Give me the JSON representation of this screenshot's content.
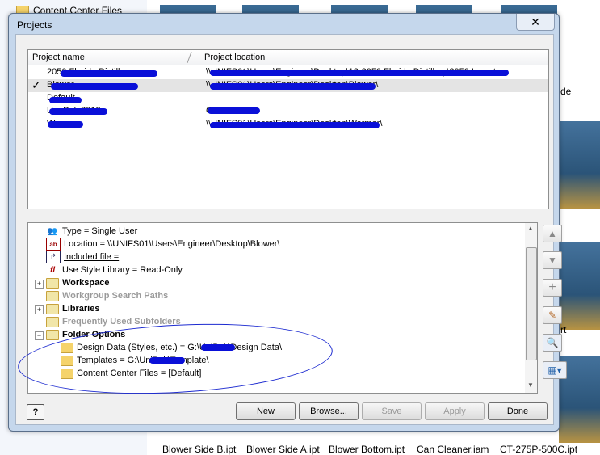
{
  "background": {
    "sidebar_item": "Content Center Files",
    "file_labels": [
      "Blower Side B.ipt",
      "Blower Side A.ipt",
      "Blower Bottom.ipt",
      "Can Cleaner.iam",
      "CT-275P-500C.ipt"
    ],
    "side_fragments": [
      "de",
      "rt"
    ]
  },
  "dialog": {
    "title": "Projects",
    "close_symbol": "✕",
    "columns": [
      "Project name",
      "Project location"
    ],
    "projects": [
      {
        "name": "2050 Florida Distillery",
        "location": "\\\\UNIFS01\\Users\\Engineer\\Desktop\\12-2050 Florida Distillery\\2050 Inventor",
        "active": false
      },
      {
        "name": "Blower",
        "location": "\\\\UNIFS01\\Users\\Engineer\\Desktop\\Blower\\",
        "active": true
      },
      {
        "name": "Default",
        "location": "",
        "active": false
      },
      {
        "name": "Uni-Pak 2012",
        "location": "G:\\UniPak\\",
        "active": false
      },
      {
        "name": "Warmer",
        "location": "\\\\UNIFS01\\Users\\Engineer\\Desktop\\Warmer\\",
        "active": false
      }
    ],
    "check_symbol": "✓",
    "tree": [
      {
        "label": "Type = Single User",
        "style": "normal",
        "icon": "type-icon"
      },
      {
        "label": "Location = \\\\UNIFS01\\Users\\Engineer\\Desktop\\Blower\\",
        "style": "normal",
        "icon": "location-icon"
      },
      {
        "label": "Included file =",
        "style": "underline",
        "icon": "included-file-icon"
      },
      {
        "label": "Use Style Library = Read-Only",
        "style": "normal",
        "icon": "style-library-icon"
      },
      {
        "label": "Workspace",
        "style": "bold",
        "icon": "workspace-icon"
      },
      {
        "label": "Workgroup Search Paths",
        "style": "grey",
        "icon": "workgroup-icon"
      },
      {
        "label": "Libraries",
        "style": "bold",
        "icon": "libraries-icon"
      },
      {
        "label": "Frequently Used Subfolders",
        "style": "grey",
        "icon": "subfolders-icon"
      },
      {
        "label": "Folder Options",
        "style": "bold",
        "icon": "folder-options-icon"
      },
      {
        "label": "Design Data (Styles, etc.) = G:\\UniPak\\Design Data\\",
        "style": "normal",
        "icon": "folder-icon"
      },
      {
        "label": "Templates = G:\\UniPak\\Template\\",
        "style": "normal",
        "icon": "folder-icon"
      },
      {
        "label": "Content Center Files = [Default]",
        "style": "normal",
        "icon": "folder-icon"
      }
    ],
    "expanders": {
      "plus": "+",
      "minus": "−"
    },
    "side_buttons": [
      "move-up-icon",
      "move-down-icon",
      "add-icon",
      "edit-icon",
      "find-icon",
      "options-icon"
    ],
    "buttons": {
      "help": "?",
      "new": "New",
      "browse": "Browse...",
      "save": "Save",
      "apply": "Apply",
      "done": "Done"
    },
    "colors": {
      "redaction": "#0a10d8",
      "dialog_frame": "#c5d7ec"
    }
  }
}
